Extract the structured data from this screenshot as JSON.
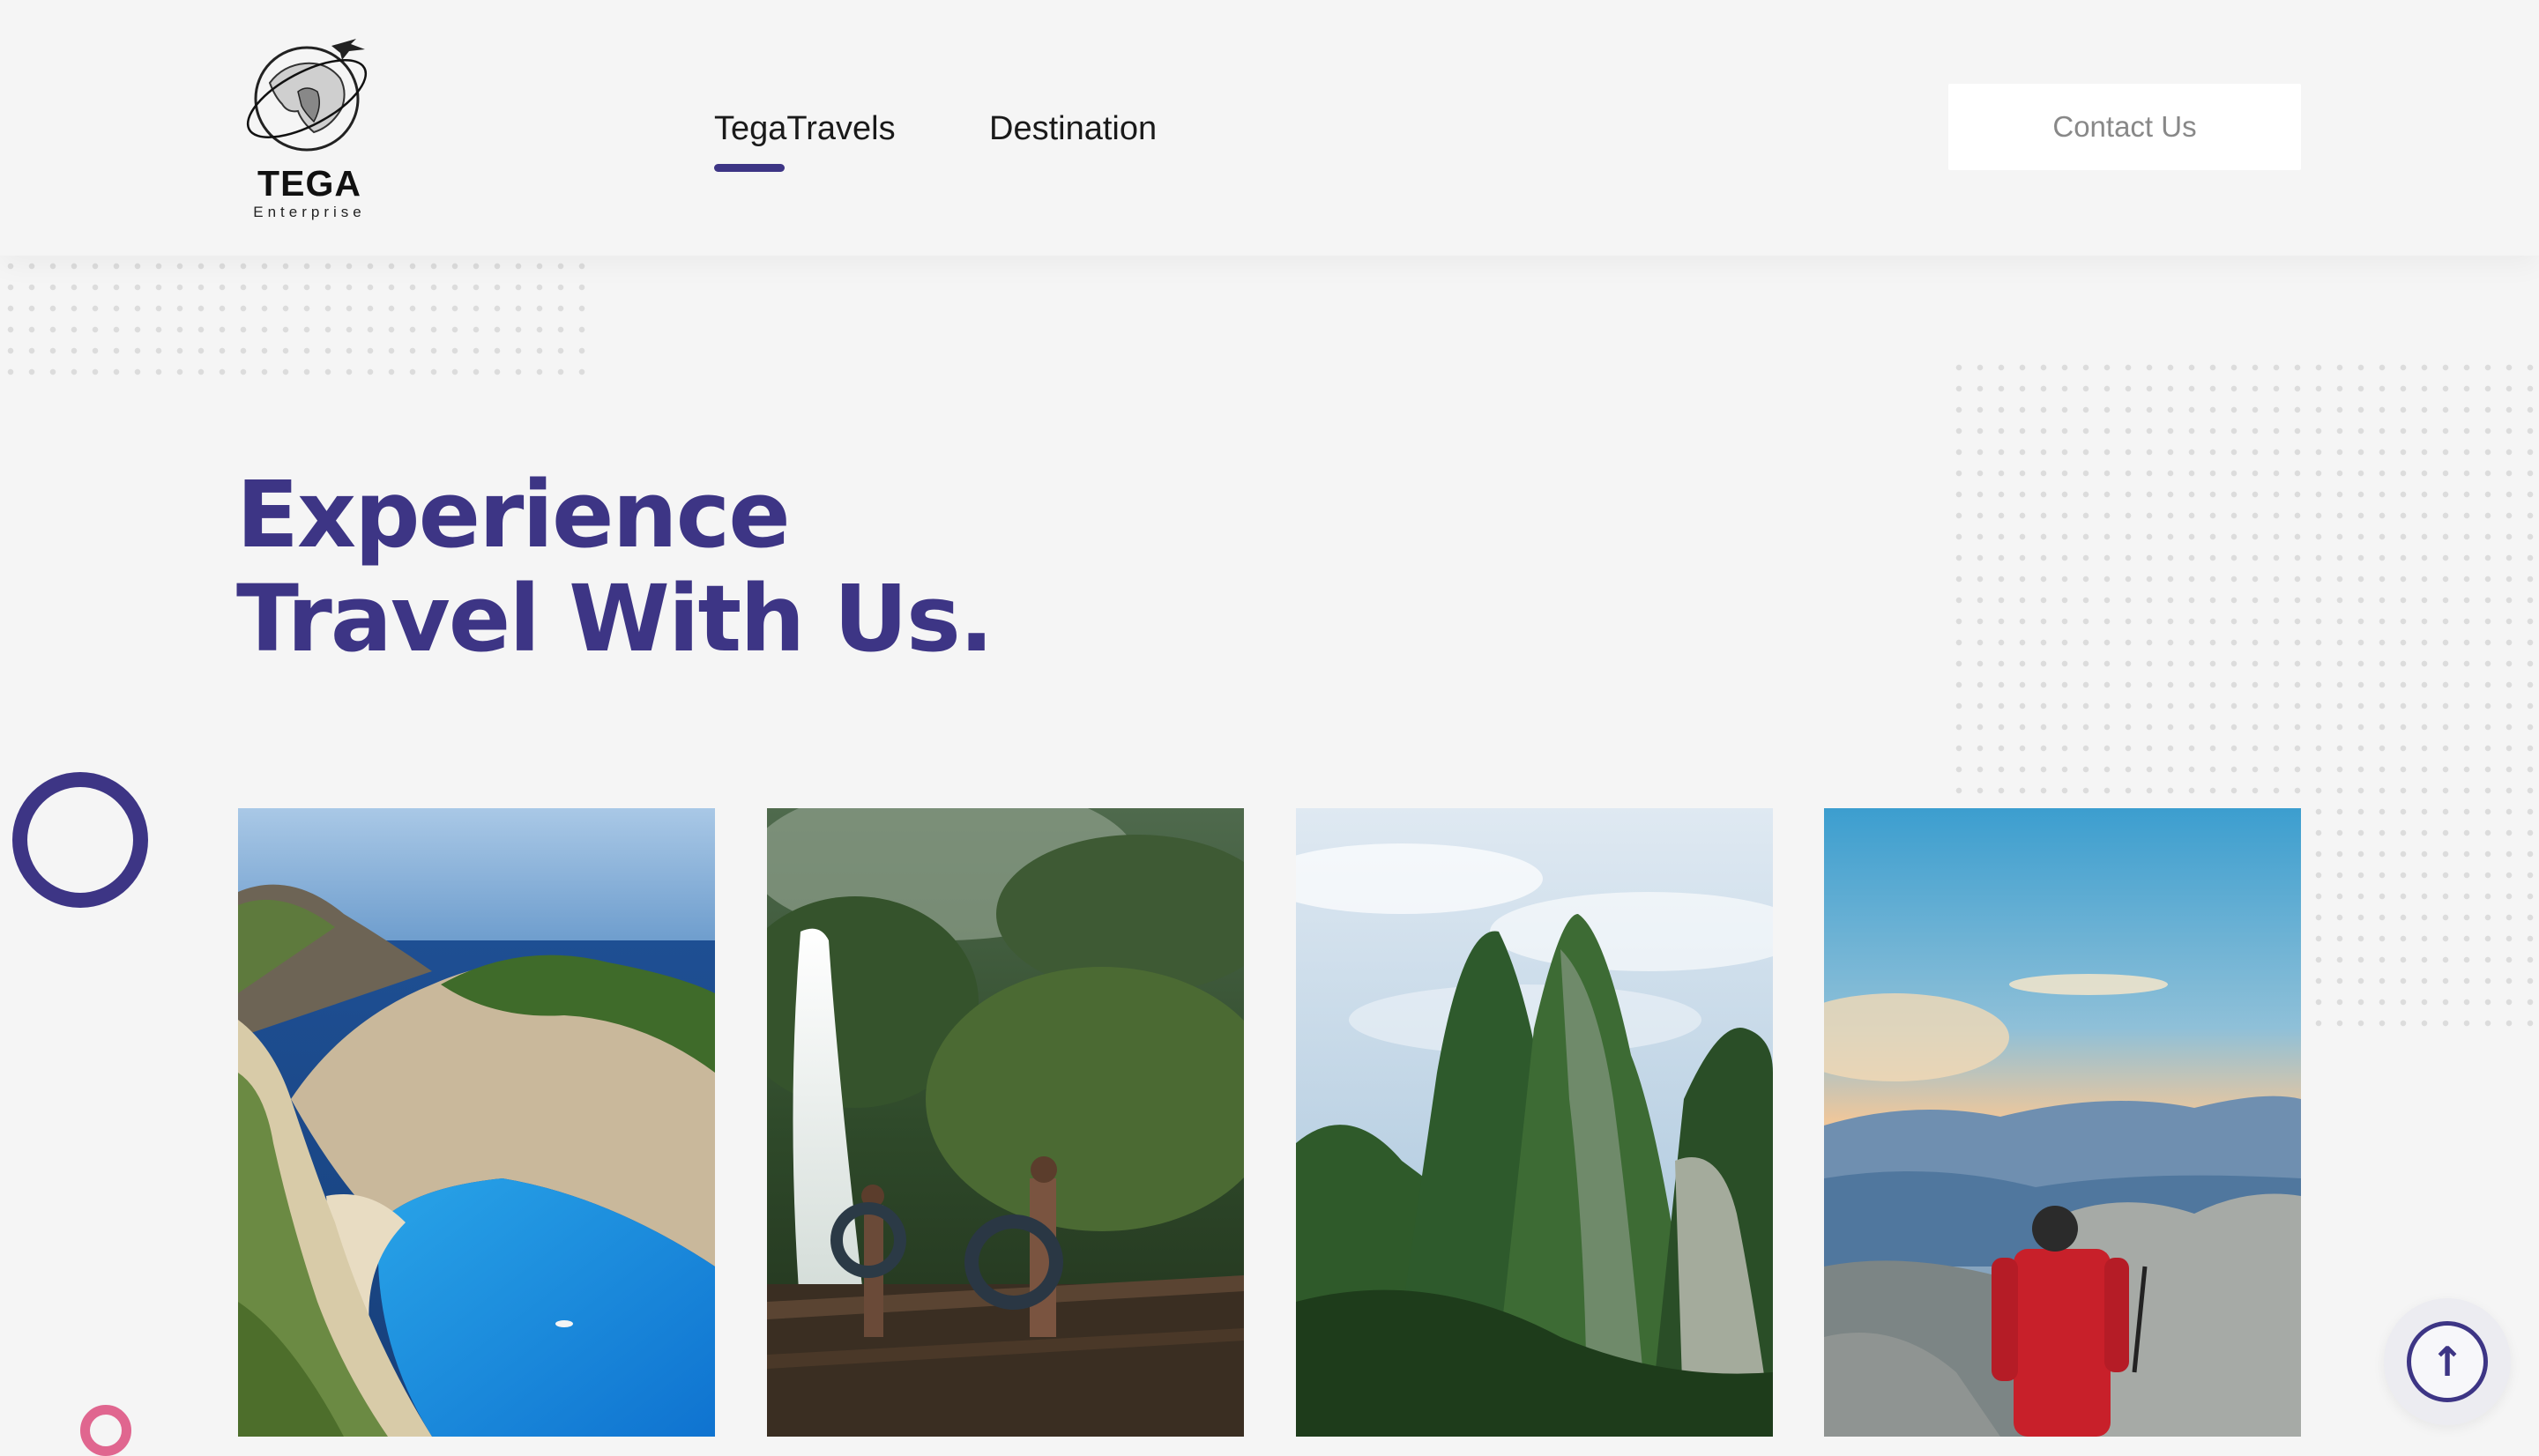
{
  "header": {
    "logo": {
      "name": "TEGA",
      "subtitle": "Enterprise",
      "icon": "globe-airplane-icon"
    },
    "nav": [
      {
        "label": "TegaTravels",
        "active": true
      },
      {
        "label": "Destination",
        "active": false
      }
    ],
    "contact_label": "Contact Us"
  },
  "hero": {
    "title_line1": "Experience",
    "title_line2": "Travel With Us."
  },
  "gallery": [
    {
      "image": "coastal-cove-beach-photo"
    },
    {
      "image": "jungle-waterfall-photo"
    },
    {
      "image": "green-mountain-peaks-photo"
    },
    {
      "image": "hiker-mountain-sunset-photo"
    }
  ],
  "scroll_top": {
    "icon": "arrow-up-icon",
    "glyph": "↑"
  },
  "colors": {
    "accent": "#3d3585",
    "pink": "#e0668f",
    "background": "#f5f5f5",
    "button": "#ffffff"
  }
}
